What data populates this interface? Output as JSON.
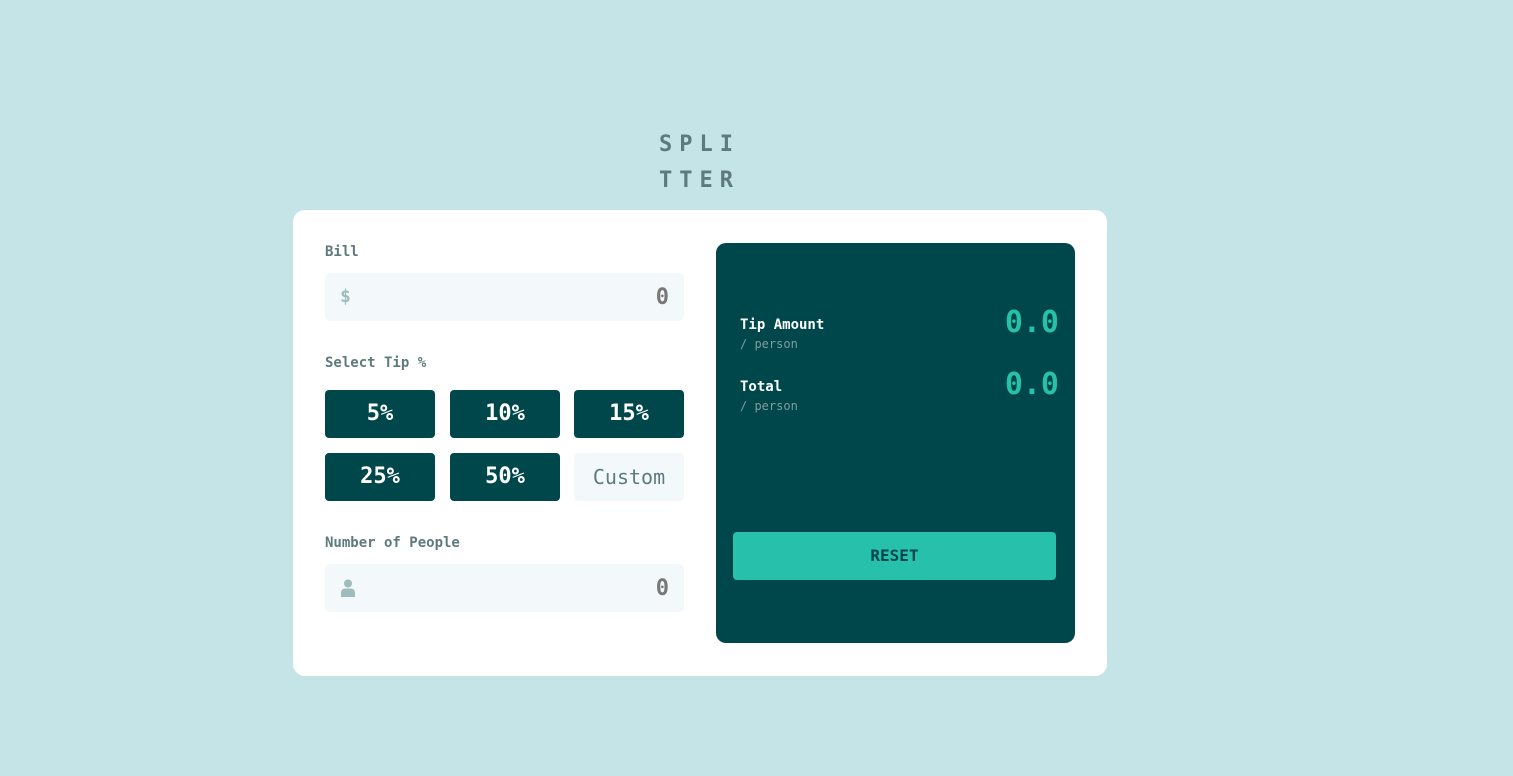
{
  "logo": {
    "line1": "SPLI",
    "line2": "TTER"
  },
  "bill": {
    "label": "Bill",
    "currency": "$",
    "value": "0"
  },
  "tip": {
    "label": "Select Tip %",
    "options": [
      "5%",
      "10%",
      "15%",
      "25%",
      "50%"
    ],
    "custom_placeholder": "Custom"
  },
  "people": {
    "label": "Number of People",
    "value": "0"
  },
  "results": {
    "tip_amount": {
      "title": "Tip Amount",
      "sub": "/ person",
      "value": "0.0"
    },
    "total": {
      "title": "Total",
      "sub": "/ person",
      "value": "0.0"
    },
    "reset_label": "RESET"
  },
  "colors": {
    "background": "#c5e4e7",
    "dark_cyan": "#00474b",
    "accent": "#26c0ab",
    "input_bg": "#f3f9fa"
  },
  "icons": {
    "bill_prefix": "dollar-icon",
    "people_prefix": "person-icon"
  }
}
